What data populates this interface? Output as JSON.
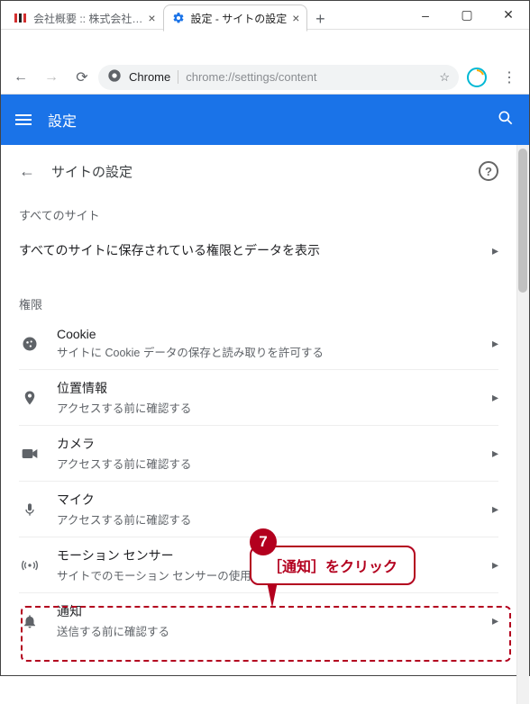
{
  "window": {
    "minimize": "–",
    "maximize": "▢",
    "close": "✕"
  },
  "tabs": [
    {
      "title": "会社概要 :: 株式会社…",
      "active": false
    },
    {
      "title": "設定 - サイトの設定",
      "active": true
    }
  ],
  "newtab_glyph": "+",
  "toolbar": {
    "back": "←",
    "forward": "→",
    "reload": "⟳",
    "url_scheme_label": "Chrome",
    "url_rest": "chrome://settings/content",
    "star": "☆",
    "menu": "⋮"
  },
  "header": {
    "title": "設定"
  },
  "page": {
    "back": "←",
    "title": "サイトの設定",
    "help": "?"
  },
  "sections": {
    "all_sites_label": "すべてのサイト",
    "all_sites_row": "すべてのサイトに保存されている権限とデータを表示",
    "permissions_label": "権限"
  },
  "perm_rows": [
    {
      "icon": "cookie",
      "title": "Cookie",
      "sub": "サイトに Cookie データの保存と読み取りを許可する"
    },
    {
      "icon": "location",
      "title": "位置情報",
      "sub": "アクセスする前に確認する"
    },
    {
      "icon": "camera",
      "title": "カメラ",
      "sub": "アクセスする前に確認する"
    },
    {
      "icon": "mic",
      "title": "マイク",
      "sub": "アクセスする前に確認する"
    },
    {
      "icon": "motion",
      "title": "モーション センサー",
      "sub": "サイトでのモーション センサーの使用を許可する"
    },
    {
      "icon": "bell",
      "title": "通知",
      "sub": "送信する前に確認する"
    }
  ],
  "annotation": {
    "step_number": "7",
    "callout_text": "［通知］をクリック"
  }
}
